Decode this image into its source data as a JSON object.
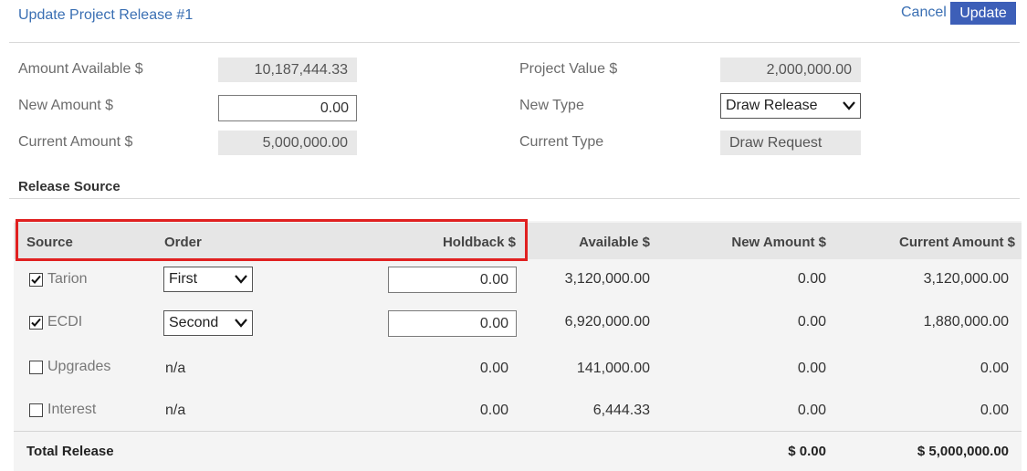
{
  "header": {
    "title": "Update Project Release #1",
    "cancel_label": "Cancel",
    "update_label": "Update"
  },
  "form": {
    "amount_available_label": "Amount Available $",
    "amount_available_value": "10,187,444.33",
    "new_amount_label": "New Amount $",
    "new_amount_value": "0.00",
    "current_amount_label": "Current Amount $",
    "current_amount_value": "5,000,000.00",
    "project_value_label": "Project Value $",
    "project_value_value": "2,000,000.00",
    "new_type_label": "New Type",
    "new_type_value": "Draw Release",
    "current_type_label": "Current Type",
    "current_type_value": "Draw Request"
  },
  "release_source": {
    "section_title": "Release Source",
    "columns": [
      "Source",
      "Order",
      "Holdback $",
      "Available $",
      "New Amount $",
      "Current Amount $"
    ],
    "rows": [
      {
        "source": "Tarion",
        "checked": true,
        "order": "First",
        "holdback": "0.00",
        "available": "3,120,000.00",
        "new_amount": "0.00",
        "current_amount": "3,120,000.00"
      },
      {
        "source": "ECDI",
        "checked": true,
        "order": "Second",
        "holdback": "0.00",
        "available": "6,920,000.00",
        "new_amount": "0.00",
        "current_amount": "1,880,000.00"
      },
      {
        "source": "Upgrades",
        "checked": false,
        "order": "n/a",
        "holdback": "0.00",
        "available": "141,000.00",
        "new_amount": "0.00",
        "current_amount": "0.00"
      },
      {
        "source": "Interest",
        "checked": false,
        "order": "n/a",
        "holdback": "0.00",
        "available": "6,444.33",
        "new_amount": "0.00",
        "current_amount": "0.00"
      }
    ],
    "total_label": "Total Release",
    "total_new_amount": "$ 0.00",
    "total_current_amount": "$ 5,000,000.00"
  },
  "colors": {
    "link": "#3a6fb3",
    "update_button": "#3d5fb8",
    "highlight": "#e02020"
  },
  "icons": {
    "dropdown": "chevron-down-icon",
    "checkbox": "checkmark-icon"
  }
}
